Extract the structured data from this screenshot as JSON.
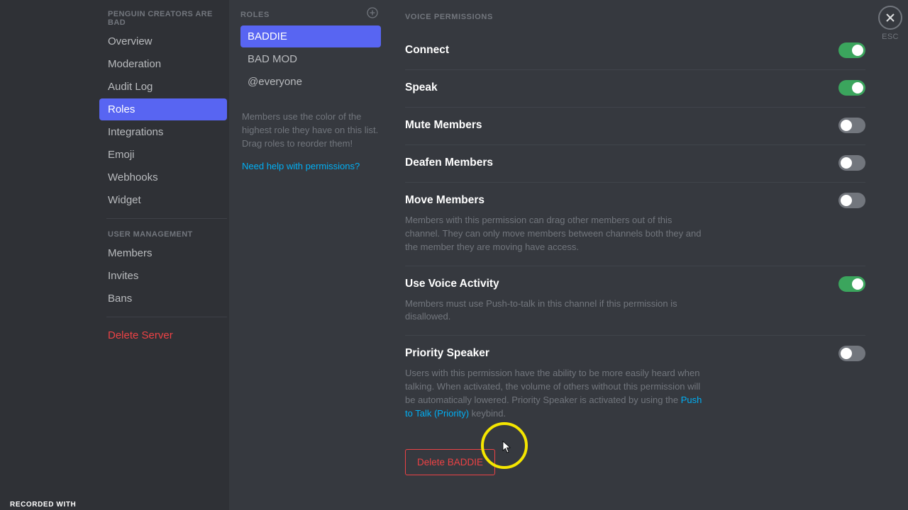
{
  "sidebar": {
    "server_category": "PENGUIN CREATORS ARE BAD",
    "items": [
      {
        "label": "Overview",
        "selected": false
      },
      {
        "label": "Moderation",
        "selected": false
      },
      {
        "label": "Audit Log",
        "selected": false
      },
      {
        "label": "Roles",
        "selected": true
      },
      {
        "label": "Integrations",
        "selected": false
      },
      {
        "label": "Emoji",
        "selected": false
      },
      {
        "label": "Webhooks",
        "selected": false
      },
      {
        "label": "Widget",
        "selected": false
      }
    ],
    "user_mgmt_header": "USER MANAGEMENT",
    "user_mgmt_items": [
      {
        "label": "Members"
      },
      {
        "label": "Invites"
      },
      {
        "label": "Bans"
      }
    ],
    "delete_server": "Delete Server"
  },
  "roles": {
    "header": "ROLES",
    "items": [
      {
        "label": "BADDIE",
        "selected": true
      },
      {
        "label": "BAD MOD",
        "selected": false
      },
      {
        "label": "@everyone",
        "selected": false
      }
    ],
    "help_text": "Members use the color of the highest role they have on this list. Drag roles to reorder them!",
    "help_link": "Need help with permissions?"
  },
  "main": {
    "section_title": "VOICE PERMISSIONS",
    "permissions": [
      {
        "label": "Connect",
        "enabled": true,
        "desc": ""
      },
      {
        "label": "Speak",
        "enabled": true,
        "desc": ""
      },
      {
        "label": "Mute Members",
        "enabled": false,
        "desc": ""
      },
      {
        "label": "Deafen Members",
        "enabled": false,
        "desc": ""
      },
      {
        "label": "Move Members",
        "enabled": false,
        "desc": "Members with this permission can drag other members out of this channel. They can only move members between channels both they and the member they are moving have access."
      },
      {
        "label": "Use Voice Activity",
        "enabled": true,
        "desc": "Members must use Push-to-talk in this channel if this permission is disallowed."
      },
      {
        "label": "Priority Speaker",
        "enabled": false,
        "desc": "Users with this permission have the ability to be more easily heard when talking. When activated, the volume of others without this permission will be automatically lowered. Priority Speaker is activated by using the ",
        "link": "Push to Talk (Priority)",
        "desc_after": " keybind."
      }
    ],
    "delete_role": "Delete BADDIE"
  },
  "close": {
    "esc": "ESC"
  },
  "watermark": "RECORDED WITH"
}
